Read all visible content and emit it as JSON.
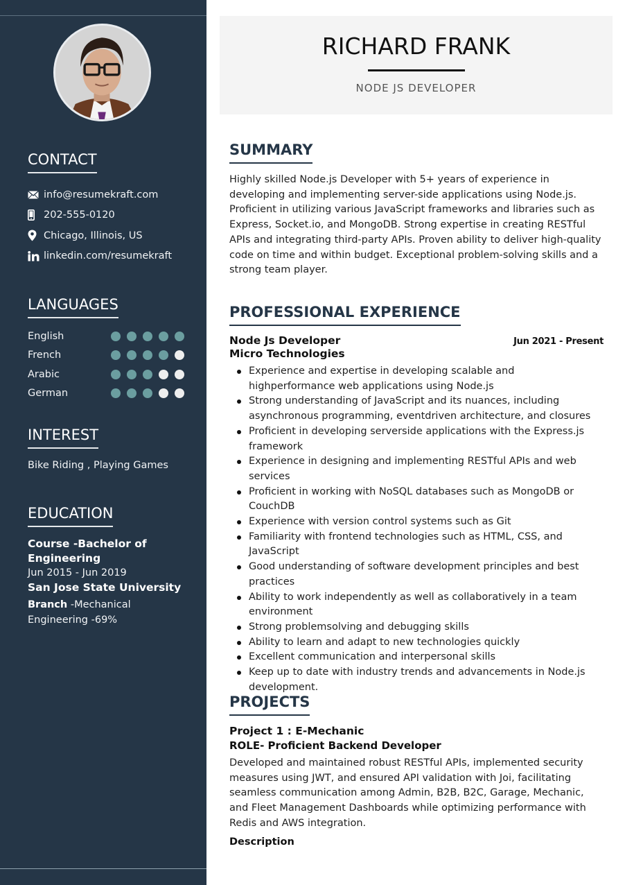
{
  "profile": {
    "name": "RICHARD FRANK",
    "title": "NODE JS DEVELOPER",
    "photo_alt": "profile-photo"
  },
  "sidebar": {
    "contact": {
      "heading": "CONTACT",
      "items": [
        {
          "icon": "envelope-icon",
          "text": "info@resumekraft.com"
        },
        {
          "icon": "mobile-phone-icon",
          "text": "202-555-0120"
        },
        {
          "icon": "map-pin-icon",
          "text": "Chicago, Illinois, US"
        },
        {
          "icon": "linkedin-icon",
          "text": "linkedin.com/resumekraft"
        }
      ]
    },
    "languages": {
      "heading": "LANGUAGES",
      "scale_max": 5,
      "items": [
        {
          "name": "English",
          "level": 5
        },
        {
          "name": "French",
          "level": 4
        },
        {
          "name": "Arabic",
          "level": 3
        },
        {
          "name": "German",
          "level": 3
        }
      ]
    },
    "interest": {
      "heading": "INTEREST",
      "text": "Bike Riding , Playing Games"
    },
    "education": {
      "heading": "EDUCATION",
      "course": "Course -Bachelor of Engineering",
      "dates": "Jun 2015 - Jun 2019",
      "school": "San Jose State University",
      "branch_label": "Branch",
      "branch_value": " -Mechanical Engineering -69%"
    }
  },
  "main": {
    "summary": {
      "heading": "SUMMARY",
      "text": "Highly skilled Node.js Developer with 5+ years of experience in developing and implementing server-side applications using Node.js. Proficient in utilizing various JavaScript frameworks and libraries such as Express, Socket.io, and MongoDB. Strong expertise in creating RESTful APIs and integrating third-party APIs. Proven ability to deliver high-quality code on time and within budget. Exceptional problem-solving skills and a strong team player."
    },
    "experience": {
      "heading": "PROFESSIONAL EXPERIENCE",
      "jobs": [
        {
          "role": "Node Js Developer",
          "dates": "Jun 2021 - Present",
          "company": "Micro Technologies",
          "bullets": [
            "Experience and expertise in developing scalable and highperformance web applications using Node.js",
            "Strong understanding of JavaScript and its nuances, including asynchronous programming, eventdriven architecture, and closures",
            "Proficient in developing serverside applications with the Express.js framework",
            "Experience in designing and implementing RESTful APIs and web services",
            "Proficient in working with NoSQL databases such as MongoDB or CouchDB",
            "Experience with version control systems such as Git",
            "Familiarity with frontend technologies such as HTML, CSS, and JavaScript",
            "Good understanding of software development principles and best practices",
            "Ability to work independently as well as collaboratively in a team environment",
            "Strong problemsolving and debugging skills",
            "Ability to learn and adapt to new technologies quickly",
            "Excellent communication and interpersonal skills",
            "Keep up to date with industry trends and advancements in Node.js development."
          ]
        }
      ]
    },
    "projects": {
      "heading": "PROJECTS",
      "items": [
        {
          "name": "Project 1 : E-Mechanic",
          "role": "ROLE- Proficient Backend Developer",
          "description": "Developed and maintained robust RESTful APIs, implemented security measures using JWT, and ensured API validation with Joi, facilitating seamless communication among Admin, B2B, B2C, Garage, Mechanic, and Fleet Management Dashboards while optimizing performance with Redis and AWS integration.",
          "label": "Description"
        }
      ]
    }
  },
  "colors": {
    "sidebar_bg": "#253647",
    "accent_dot": "#6b9ea0",
    "empty_dot": "#eeeeee",
    "header_bg": "#f4f4f4",
    "heading_text": "#253647"
  }
}
